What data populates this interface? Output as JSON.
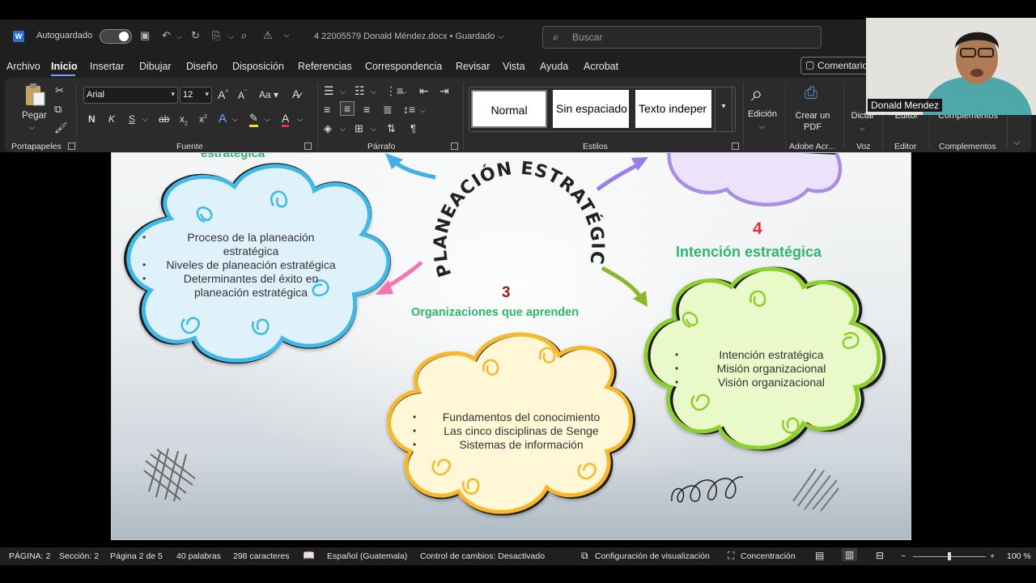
{
  "app": {
    "autosave_label": "Autoguardado",
    "doc_title": "4 22005579 Donald Méndez.docx • Guardado ⌵",
    "search_placeholder": "Buscar"
  },
  "menu": {
    "items": [
      "Archivo",
      "Inicio",
      "Insertar",
      "Dibujar",
      "Diseño",
      "Disposición",
      "Referencias",
      "Correspondencia",
      "Revisar",
      "Vista",
      "Ayuda",
      "Acrobat"
    ],
    "comment_button": "Comentario"
  },
  "ribbon": {
    "paste_label": "Pegar",
    "font_name": "Arial",
    "font_size": "12",
    "styles": [
      "Normal",
      "Sin espaciado",
      "Texto indeper"
    ],
    "edit_label": "Edición",
    "create_pdf_label": "Crear un PDF",
    "dictate_label": "Dictar",
    "editor_label": "Editor",
    "complements_label": "Complementos",
    "groups": {
      "clipboard": "Portapapeles",
      "font": "Fuente",
      "paragraph": "Párrafo",
      "styles": "Estilos",
      "adobe": "Adobe Acr...",
      "voice": "Voz",
      "editor": "Editor",
      "complements": "Complementos"
    }
  },
  "webcam": {
    "name": "Donald Mendez"
  },
  "document": {
    "center_title": "PLANEACIÓN ESTRATÉGICA",
    "top_left_header_fragment": "estratégica",
    "cloud1_items": [
      "Proceso de la planeación estratégica",
      "Niveles de planeación estratégica",
      "Determinantes del éxito en planeación estratégica"
    ],
    "section3_number": "3",
    "section3_header": "Organizaciones que aprenden",
    "cloud3_items": [
      "Fundamentos del conocimiento",
      "Las cinco disciplinas de Senge",
      "Sistemas de información"
    ],
    "section4_number": "4",
    "section4_header": "Intención estratégica",
    "cloud4_items": [
      "Intención estratégica",
      "Misión organizacional",
      "Visión organizacional"
    ]
  },
  "statusbar": {
    "page": "PÁGINA: 2",
    "section": "Sección: 2",
    "page_of": "Página 2 de 5",
    "words": "40 palabras",
    "chars": "298 caracteres",
    "language": "Español (Guatemala)",
    "track_changes": "Control de cambios: Desactivado",
    "display_settings": "Configuración de visualización",
    "focus": "Concentración",
    "zoom": "100 %"
  },
  "colors": {
    "accent": "#6ea7ff",
    "green_header": "#2fb56e",
    "number_red": "#e8303a",
    "number_dark_red": "#9b1b1b"
  }
}
